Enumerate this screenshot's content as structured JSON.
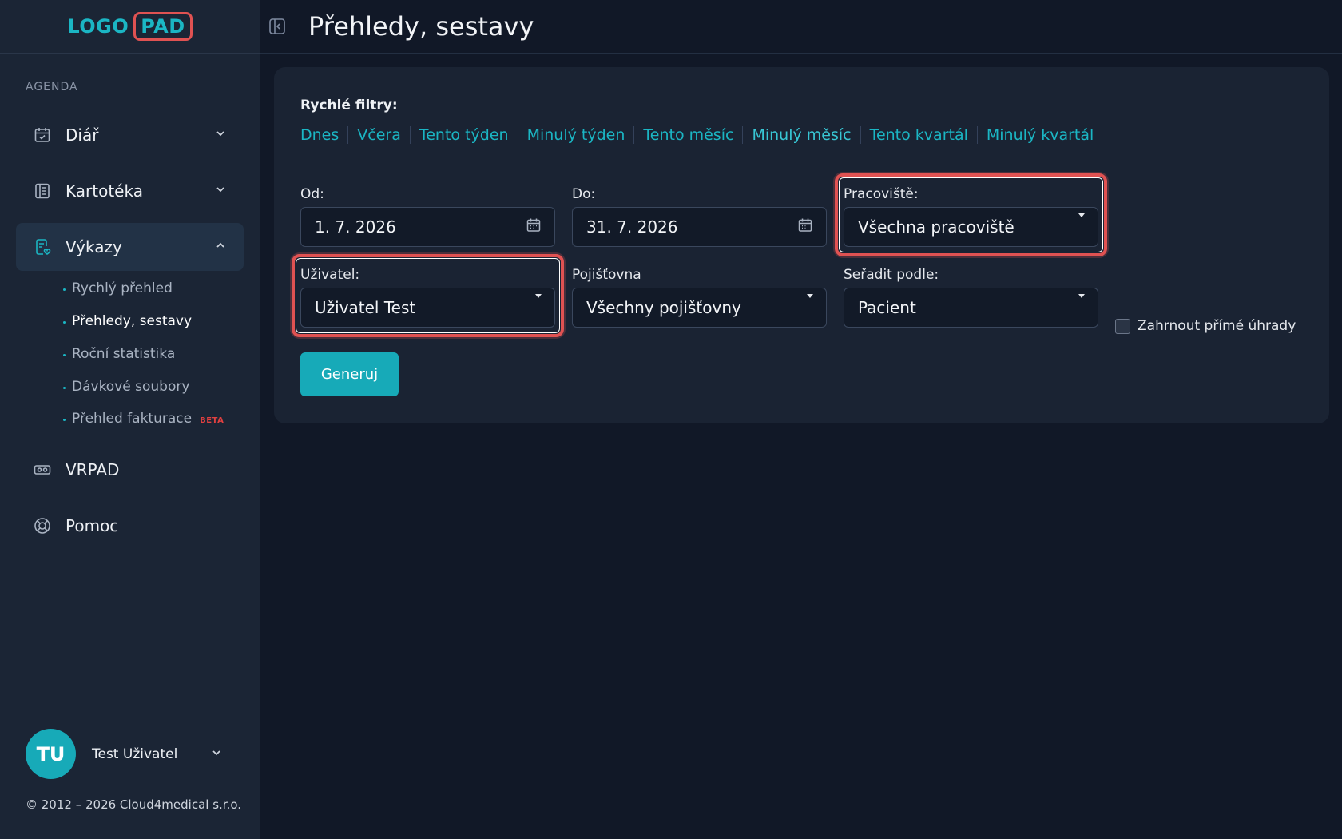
{
  "logo": {
    "part1": "LOGO",
    "part2": "PAD"
  },
  "header": {
    "title": "Přehledy, sestavy"
  },
  "sidebar": {
    "section_label": "AGENDA",
    "items": [
      {
        "label": "Diář",
        "icon": "calendar-check-icon"
      },
      {
        "label": "Kartotéka",
        "icon": "notebook-icon"
      },
      {
        "label": "Výkazy",
        "icon": "report-icon"
      },
      {
        "label": "VRPAD",
        "icon": "vr-headset-icon"
      },
      {
        "label": "Pomoc",
        "icon": "lifebuoy-icon"
      }
    ],
    "subitems": [
      {
        "label": "Rychlý přehled"
      },
      {
        "label": "Přehledy, sestavy"
      },
      {
        "label": "Roční statistika"
      },
      {
        "label": "Dávkové soubory"
      },
      {
        "label": "Přehled fakturace",
        "badge": "BETA"
      }
    ],
    "user": {
      "initials": "TU",
      "name": "Test Uživatel"
    },
    "copyright": "© 2012 – 2026 Cloud4medical s.r.o."
  },
  "filters": {
    "quick_label": "Rychlé filtry:",
    "quick_links": [
      "Dnes",
      "Včera",
      "Tento týden",
      "Minulý týden",
      "Tento měsíc",
      "Minulý měsíc",
      "Tento kvartál",
      "Minulý kvartál"
    ],
    "from": {
      "label": "Od:",
      "value": "1. 7. 2026"
    },
    "to": {
      "label": "Do:",
      "value": "31. 7. 2026"
    },
    "workplace": {
      "label": "Pracoviště:",
      "value": "Všechna pracoviště"
    },
    "user": {
      "label": "Uživatel:",
      "value": "Uživatel Test"
    },
    "insurer": {
      "label": "Pojišťovna",
      "value": "Všechny pojišťovny"
    },
    "sort": {
      "label": "Seřadit podle:",
      "value": "Pacient"
    },
    "direct_payments": {
      "label": "Zahrnout přímé úhrady",
      "checked": false
    },
    "generate_label": "Generuj"
  },
  "colors": {
    "accent": "#1bb6c4",
    "highlight": "#e05252",
    "background": "#111827",
    "sidebar": "#1b2535"
  }
}
